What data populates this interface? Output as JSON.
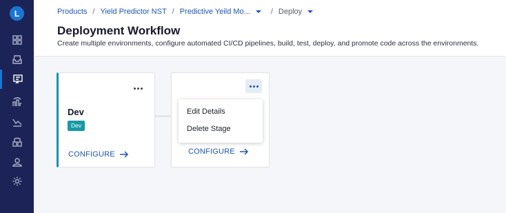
{
  "sidebar": {
    "logo_letter": "L",
    "items": [
      {
        "icon": "grid-icon"
      },
      {
        "icon": "inbox-icon"
      },
      {
        "icon": "deploy-icon",
        "active": true
      },
      {
        "icon": "data-icon"
      },
      {
        "icon": "trend-icon"
      },
      {
        "icon": "model-icon"
      },
      {
        "icon": "users-icon"
      },
      {
        "icon": "gear-icon"
      }
    ]
  },
  "breadcrumb": {
    "items": [
      "Products",
      "Yield Predictor NST",
      "Predictive Yeild Mo...",
      "Deploy"
    ],
    "separator": "/"
  },
  "page": {
    "title": "Deployment Workflow",
    "description": "Create multiple environments, configure automated CI/CD pipelines, build, test, deploy, and promote code across the environments."
  },
  "stages": [
    {
      "name": "Dev",
      "badge": "Dev",
      "configure_label": "CONFIGURE"
    },
    {
      "configure_label": "CONFIGURE"
    }
  ],
  "menu": {
    "items": [
      "Edit Details",
      "Delete Stage"
    ]
  },
  "colors": {
    "sidebar_bg": "#1c2356",
    "accent": "#1c55b8",
    "badge": "#1899a8"
  }
}
